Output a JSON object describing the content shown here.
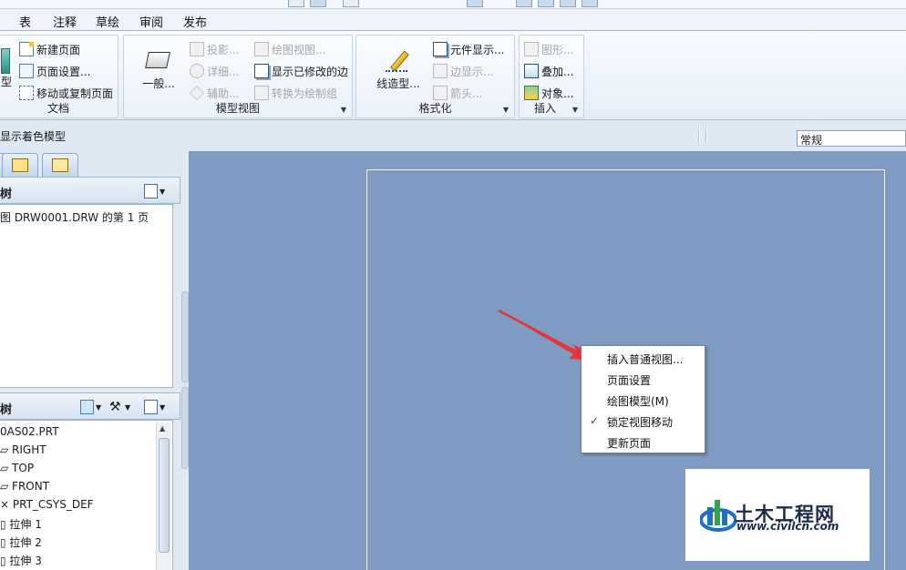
{
  "menu_tabs": [
    "表",
    "注释",
    "草绘",
    "审阅",
    "发布"
  ],
  "ribbon": {
    "groups": {
      "document": {
        "label": "文档",
        "big_button_label": "型",
        "items": [
          "新建页面",
          "页面设置...",
          "移动或复制页面"
        ]
      },
      "model_views": {
        "label": "模型视图",
        "big_button_label": "一般...",
        "col1": [
          "投影...",
          "详细...",
          "辅助..."
        ],
        "col2": [
          "绘图视图...",
          "显示已修改的边",
          "转换为绘制组"
        ]
      },
      "format": {
        "label": "格式化",
        "big_button_label": "线造型...",
        "items": [
          "元件显示...",
          "边显示...",
          "箭头..."
        ]
      },
      "insert": {
        "label": "插入",
        "items": [
          "图形...",
          "叠加...",
          "对象..."
        ]
      }
    }
  },
  "status": {
    "message": "显示着色模型",
    "filter_value": "常规"
  },
  "left_panel": {
    "drawing_tree": {
      "title": "树",
      "item": "图 DRW0001.DRW 的第 1 页"
    },
    "model_tree": {
      "title": "树",
      "items": [
        "0AS02.PRT",
        "RIGHT",
        "TOP",
        "FRONT",
        "PRT_CSYS_DEF",
        "拉伸 1",
        "拉伸 2",
        "拉伸 3"
      ]
    }
  },
  "context_menu": {
    "items": [
      {
        "label": "插入普通视图...",
        "checked": false
      },
      {
        "label": "页面设置",
        "checked": false
      },
      {
        "label": "绘图模型(M)",
        "checked": false
      },
      {
        "label": "锁定视图移动",
        "checked": true
      },
      {
        "label": "更新页面",
        "checked": false
      }
    ],
    "check_glyph": "✓"
  },
  "watermark": {
    "name": "土木工程网",
    "url": "www.civilcn.com"
  },
  "colors": {
    "canvas": "#7e9cc1",
    "arrow": "#e8333a",
    "accent": "#1f4f8a"
  }
}
